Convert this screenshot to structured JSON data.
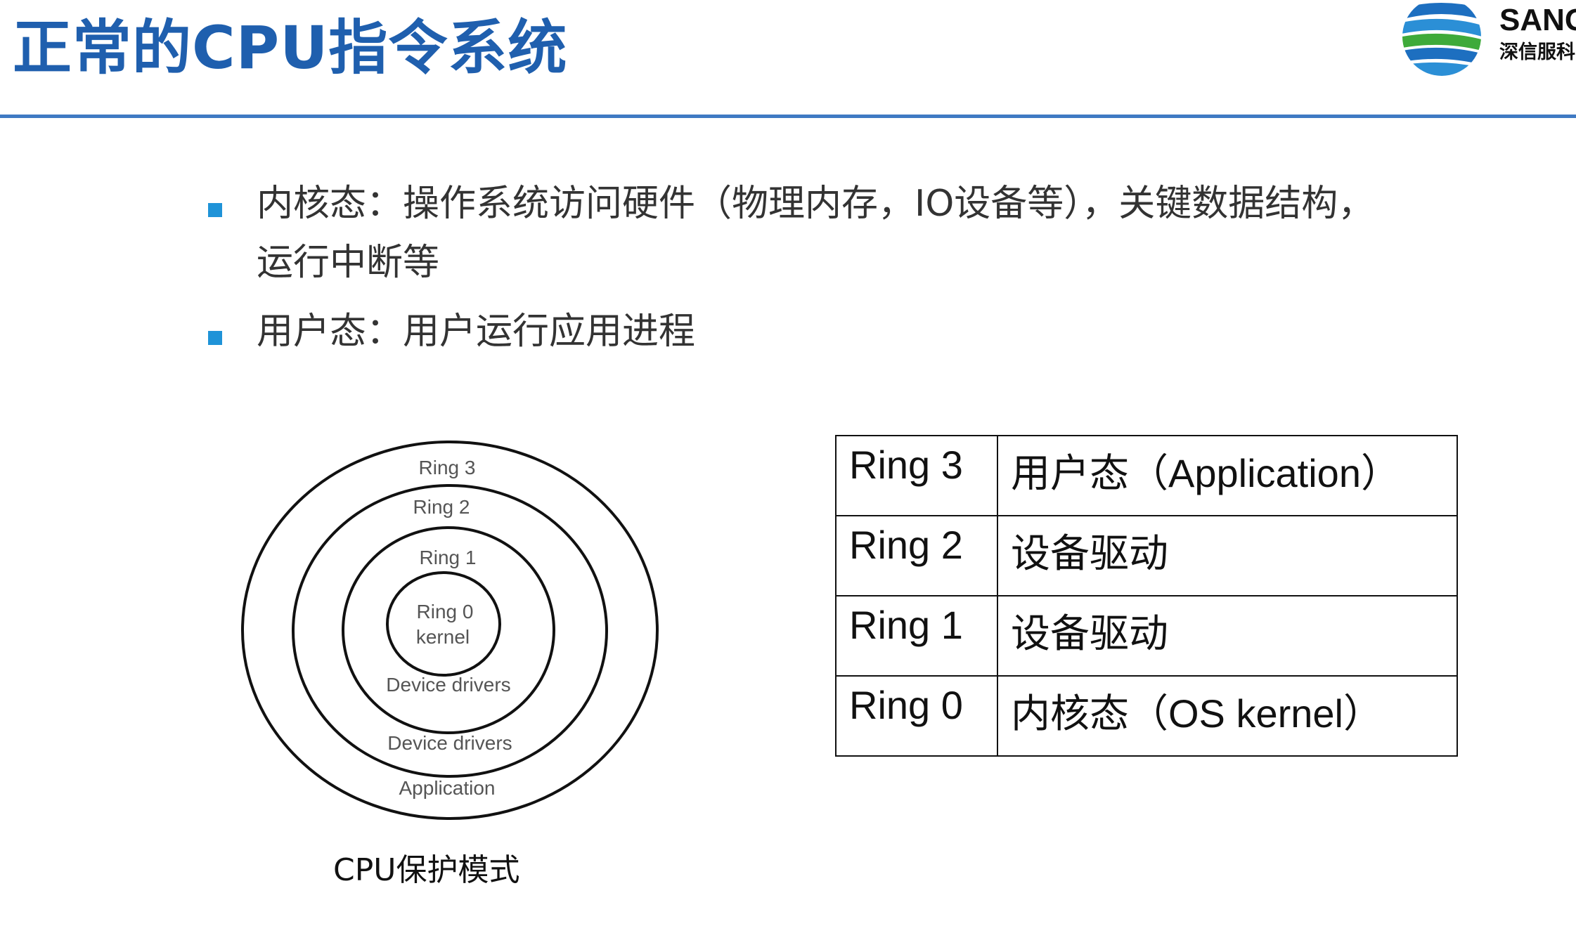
{
  "title": "正常的CPU指令系统",
  "logo": {
    "word": "SANG",
    "sub": "深信服科"
  },
  "bullets": [
    {
      "line1": "内核态：操作系统访问硬件（物理内存，IO设备等），关键数据结构，",
      "line2": "运行中断等"
    },
    {
      "line1": "用户态：用户运行应用进程",
      "line2": ""
    }
  ],
  "diagram": {
    "labels": {
      "ring3": "Ring 3",
      "ring2": "Ring 2",
      "ring1": "Ring 1",
      "ring0": "Ring 0",
      "kernel": "kernel",
      "drivers_inner": "Device drivers",
      "drivers_outer": "Device drivers",
      "application": "Application"
    },
    "caption": "CPU保护模式"
  },
  "table": [
    {
      "ring": "Ring 3",
      "desc": "用户态（Application）"
    },
    {
      "ring": "Ring 2",
      "desc": "设备驱动"
    },
    {
      "ring": "Ring 1",
      "desc": "设备驱动"
    },
    {
      "ring": "Ring 0",
      "desc": "内核态（OS  kernel）"
    }
  ],
  "colors": {
    "title": "#1f5fae",
    "rule": "#3f7ac3",
    "bullet": "#1f93d8"
  }
}
